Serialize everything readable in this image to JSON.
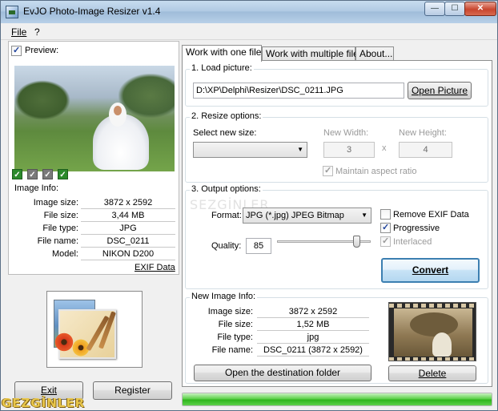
{
  "window": {
    "title": "EvJO Photo-Image Resizer v1.4",
    "controls": {
      "minimize": "—",
      "maximize": "☐",
      "close": "✕"
    }
  },
  "menu": {
    "file": "File",
    "help": "?"
  },
  "left": {
    "preview_label": "Preview:",
    "preview_checked": true,
    "photo_checks": [
      "✓",
      "✓",
      "✓",
      "✓"
    ],
    "image_info_label": "Image Info:",
    "info": [
      {
        "key": "Image size:",
        "value": "3872 x 2592"
      },
      {
        "key": "File size:",
        "value": "3,44 MB"
      },
      {
        "key": "File type:",
        "value": "JPG"
      },
      {
        "key": "File name:",
        "value": "DSC_0211"
      },
      {
        "key": "Model:",
        "value": "NIKON D200"
      }
    ],
    "exif_link": "EXIF Data",
    "exit_button": "Exit",
    "register_button": "Register"
  },
  "tabs": [
    "Work with one file",
    "Work with multiple files",
    "About..."
  ],
  "load": {
    "title": "1. Load picture:",
    "path": "D:\\XP\\Delphi\\Resizer\\DSC_0211.JPG",
    "open_button": "Open Picture"
  },
  "resize": {
    "title": "2. Resize options:",
    "select_label": "Select new size:",
    "select_value": "",
    "width_label": "New Width:",
    "width_value": "3",
    "x_label": "x",
    "height_label": "New Height:",
    "height_value": "4",
    "aspect_label": "Maintain aspect ratio",
    "aspect_checked": true
  },
  "output": {
    "title": "3. Output options:",
    "format_label": "Format:",
    "format_value": "JPG (*.jpg) JPEG Bitmap",
    "quality_label": "Quality:",
    "quality_value": "85",
    "quality_level": 0.85,
    "remove_exif_label": "Remove EXIF Data",
    "remove_exif_checked": false,
    "progressive_label": "Progressive",
    "progressive_checked": true,
    "interlaced_label": "Interlaced",
    "interlaced_checked": true,
    "convert_button": "Convert"
  },
  "new_info": {
    "title": "New Image Info:",
    "rows": [
      {
        "key": "Image size:",
        "value": "3872 x 2592"
      },
      {
        "key": "File size:",
        "value": "1,52 MB"
      },
      {
        "key": "File type:",
        "value": "jpg"
      },
      {
        "key": "File name:",
        "value": "DSC_0211 (3872 x 2592)"
      }
    ],
    "open_folder_button": "Open the destination folder",
    "delete_button": "Delete"
  },
  "progress": {
    "percent": 100,
    "color": "#2fb51c"
  },
  "watermarks": {
    "bottom": "GEZGİNLER",
    "middle": "SEZGİNLER"
  }
}
